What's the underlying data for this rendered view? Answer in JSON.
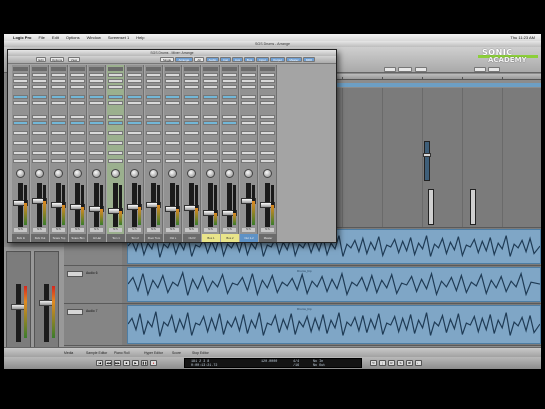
{
  "menubar": {
    "app": "Logic Pro",
    "items": [
      "File",
      "Edit",
      "Options",
      "Window",
      "Screenset 1",
      "Help"
    ],
    "clock": "Thu 11:23 AM"
  },
  "arrange": {
    "title": "SGS Drums - Arrange"
  },
  "mixer": {
    "title": "SGS Drums - Mixer: Arrange",
    "toolbar": [
      "Edit",
      "Options",
      "View"
    ],
    "tabs": [
      "Single",
      "Arrange",
      "All",
      "Audio",
      "Inst",
      "Aux",
      "Bus",
      "Input",
      "Output",
      "Master",
      "MIDI"
    ],
    "strips": [
      {
        "name": "Kick In",
        "style": "grey",
        "level": 0.55
      },
      {
        "name": "Kick Out",
        "style": "grey",
        "level": 0.6
      },
      {
        "name": "Snare Top",
        "style": "grey",
        "level": 0.5
      },
      {
        "name": "Snare Btm",
        "style": "grey",
        "level": 0.45
      },
      {
        "name": "Hi Hat",
        "style": "grey",
        "level": 0.4
      },
      {
        "name": "Tom 1",
        "style": "sel",
        "level": 0.35
      },
      {
        "name": "Tom 2",
        "style": "grey",
        "level": 0.45
      },
      {
        "name": "Floor Tom",
        "style": "grey",
        "level": 0.5
      },
      {
        "name": "OH L",
        "style": "grey",
        "level": 0.4
      },
      {
        "name": "OH R",
        "style": "grey",
        "level": 0.42
      },
      {
        "name": "Bus 1",
        "style": "yellow",
        "level": 0.3
      },
      {
        "name": "Bus 2",
        "style": "yellow",
        "level": 0.3
      },
      {
        "name": "Out 1-2",
        "style": "blue",
        "level": 0.6
      },
      {
        "name": "Master",
        "style": "grey",
        "level": 0.5
      }
    ]
  },
  "logo": {
    "line1": "SONIC",
    "line2": "ACADEMY"
  },
  "regions": [
    {
      "name": "Drums_bip"
    },
    {
      "name": "Drums_bip"
    },
    {
      "name": "Drums_bip"
    }
  ],
  "tracks": [
    "Audio 5",
    "Audio 6",
    "Audio 7"
  ],
  "inspector": {
    "left_label": "Drums",
    "right_label": "Out 1-2"
  },
  "bottom_bar": [
    "Media",
    "Sample Editor",
    "Piano Roll",
    "Hyper Editor",
    "Score",
    "Stop Editor"
  ],
  "transport": {
    "position": "181 2 3 8",
    "bars": "0:00:13:21.72",
    "tempo": "120.0000",
    "signature": "4/4",
    "division": "/16",
    "in": "No In",
    "out": "No Out"
  },
  "colors": {
    "accent": "#7fa6c6",
    "strip_selected": "#9bb08e",
    "yellow": "#e9e48a"
  }
}
